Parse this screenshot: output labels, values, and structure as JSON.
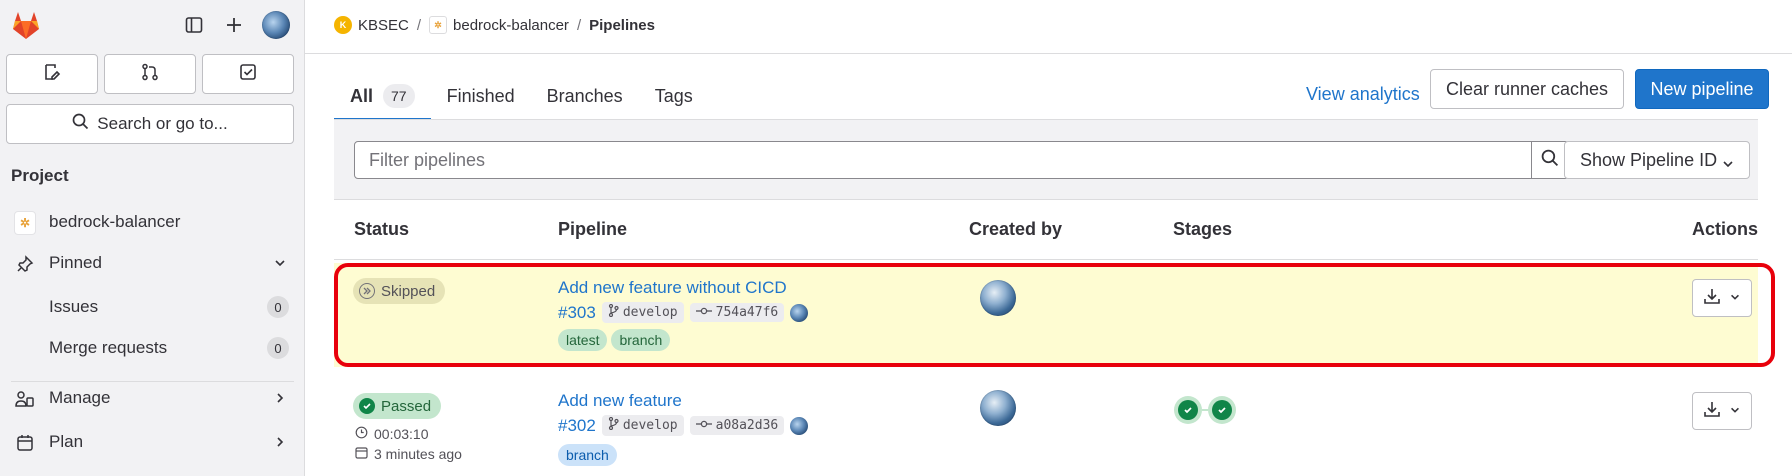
{
  "sidebar": {
    "search_label": "Search or go to...",
    "section_title": "Project",
    "project_name": "bedrock-balancer",
    "items": [
      {
        "label": "Pinned"
      },
      {
        "label": "Issues",
        "count": "0"
      },
      {
        "label": "Merge requests",
        "count": "0"
      },
      {
        "label": "Manage"
      },
      {
        "label": "Plan"
      }
    ]
  },
  "breadcrumb": {
    "group": "KBSEC",
    "project": "bedrock-balancer",
    "current": "Pipelines"
  },
  "tabs": [
    {
      "label": "All",
      "count": "77"
    },
    {
      "label": "Finished"
    },
    {
      "label": "Branches"
    },
    {
      "label": "Tags"
    }
  ],
  "actions": {
    "view_analytics": "View analytics",
    "clear_caches": "Clear runner caches",
    "new_pipeline": "New pipeline"
  },
  "filter": {
    "placeholder": "Filter pipelines",
    "id_select": "Show Pipeline ID"
  },
  "table": {
    "headers": [
      "Status",
      "Pipeline",
      "Created by",
      "Stages",
      "Actions"
    ],
    "rows": [
      {
        "status": "Skipped",
        "title": "Add new feature without CICD",
        "id": "#303",
        "branch": "develop",
        "commit": "754a47f6",
        "tags": [
          "latest",
          "branch"
        ]
      },
      {
        "status": "Passed",
        "duration": "00:03:10",
        "created": "3 minutes ago",
        "title": "Add new feature",
        "id": "#302",
        "branch": "develop",
        "commit": "a08a2d36",
        "tags": [
          "branch"
        ]
      }
    ]
  },
  "colors": {
    "accent": "#1f75cb",
    "highlight": "#e8000b",
    "skipped_row": "#fefcd2",
    "success": "#108548"
  }
}
